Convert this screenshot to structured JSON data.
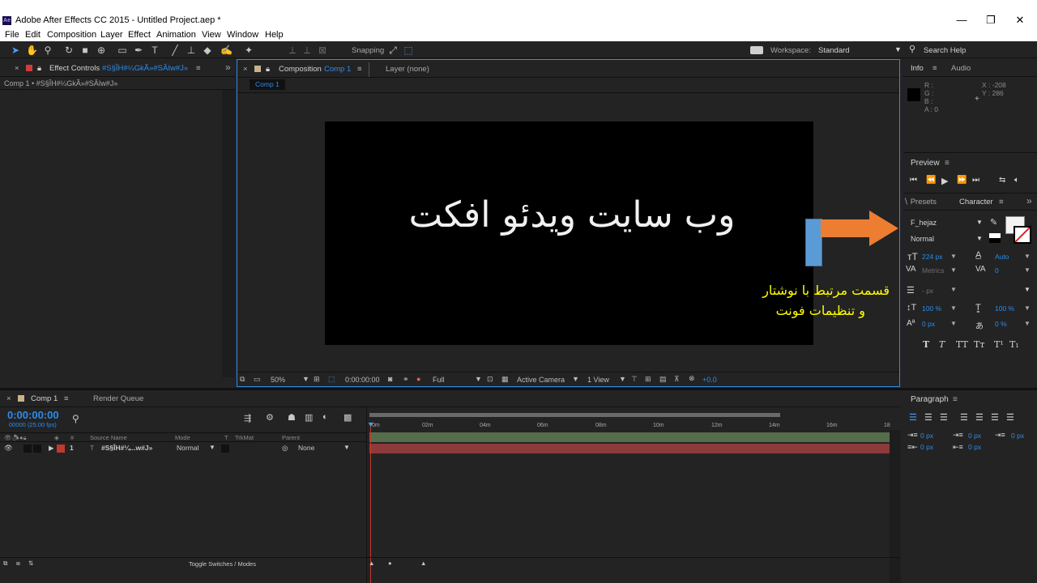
{
  "window": {
    "logo": "Ae",
    "title": "Adobe After Effects CC 2015 - Untitled Project.aep *",
    "minimize": "—",
    "restore": "❐",
    "close": "✕"
  },
  "menu": [
    "File",
    "Edit",
    "Composition",
    "Layer",
    "Effect",
    "Animation",
    "View",
    "Window",
    "Help"
  ],
  "toolbar": {
    "snapping_label": "Snapping",
    "workspace_label": "Workspace:",
    "workspace_value": "Standard",
    "search_help": "Search Help"
  },
  "effect_controls": {
    "close": "×",
    "tab_label": "Effect Controls",
    "tab_layer": "#S§ÎH#¼GkÃ»#SÂIw#J»",
    "menu": "≡",
    "expand": "»",
    "path": "Comp 1 • #S§ÎH#¼GkÃ»#SÂIw#J»"
  },
  "composition": {
    "close": "×",
    "tab_label": "Composition",
    "tab_comp": "Comp 1",
    "menu": "≡",
    "layer_tab": "Layer (none)",
    "breadcrumb": "Comp 1",
    "canvas_text": "وب سایت ویدئو افکت",
    "annotation_line1": "قسمت مرتبط با نوشتار",
    "annotation_line2": "و تنظیمات فونت",
    "colors": {
      "arrow": "#ed7d31",
      "bar": "#5b9bd5",
      "annotation": "#ffff00"
    },
    "footer": {
      "zoom": "50%",
      "timecode": "0:00:00:00",
      "resolution": "Full",
      "camera": "Active Camera",
      "views": "1 View",
      "exposure": "+0.0"
    }
  },
  "info": {
    "tab": "Info",
    "menu": "≡",
    "audio_tab": "Audio",
    "r": "R :",
    "g": "G :",
    "b": "B :",
    "a": "A : 0",
    "x": "X : -208",
    "y": "Y : 286"
  },
  "preview": {
    "title": "Preview",
    "menu": "≡"
  },
  "character": {
    "presets_tab": "∖ Presets",
    "tab": "Character",
    "menu": "≡",
    "expand": "»",
    "font": "F_hejaz",
    "style": "Normal",
    "size": "224 px",
    "leading": "Auto",
    "kerning": "Metrics",
    "tracking": "0",
    "stroke": "- px",
    "vscale": "100 %",
    "hscale": "100 %",
    "baseline": "0 px",
    "tsume": "0 %",
    "styles": [
      "T",
      "T",
      "TT",
      "Tт",
      "T¹",
      "T₁"
    ]
  },
  "timeline": {
    "close": "×",
    "tab": "Comp 1",
    "menu": "≡",
    "render_queue": "Render Queue",
    "timecode": "0:00:00:00",
    "frames": "00000 (25.00 fps)",
    "ruler": [
      "0m",
      "02m",
      "04m",
      "06m",
      "08m",
      "10m",
      "12m",
      "14m",
      "16m",
      "18"
    ],
    "columns": {
      "hash": "#",
      "source": "Source Name",
      "mode": "Mode",
      "t": "T",
      "trkmat": "TrkMat",
      "parent": "Parent"
    },
    "layer": {
      "number": "1",
      "name": "#S§ÎH#¼...w#J»",
      "mode": "Normal",
      "parent": "None"
    },
    "toggle": "Toggle Switches / Modes"
  },
  "paragraph": {
    "title": "Paragraph",
    "menu": "≡",
    "indent_left": "0 px",
    "indent_first": "0 px",
    "indent_right": "0 px",
    "space_before": "0 px",
    "space_after": "0 px"
  }
}
